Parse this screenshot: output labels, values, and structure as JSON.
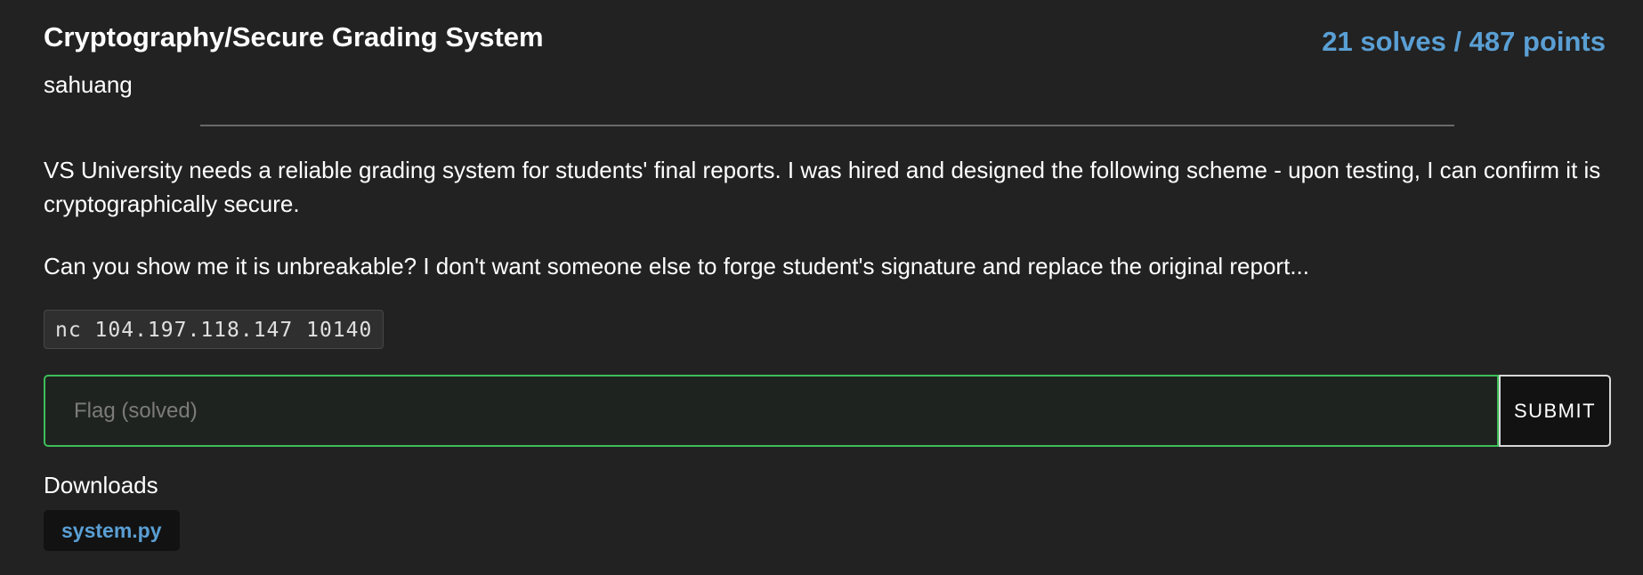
{
  "challenge": {
    "title": "Cryptography/Secure Grading System",
    "score": "21 solves / 487 points",
    "author": "sahuang",
    "description": [
      "VS University needs a reliable grading system for students' final reports. I was hired and designed the following scheme - upon testing, I can confirm it is cryptographically secure.",
      "Can you show me it is unbreakable? I don't want someone else to forge student's signature and replace the original report..."
    ],
    "connection": "nc 104.197.118.147 10140"
  },
  "flag_form": {
    "placeholder": "Flag (solved)",
    "value": "",
    "submit_label": "SUBMIT"
  },
  "downloads": {
    "label": "Downloads",
    "files": [
      {
        "name": "system.py"
      }
    ]
  },
  "colors": {
    "background": "#222222",
    "accent": "#5a9fd4",
    "solved_border": "#3dbe5a"
  }
}
